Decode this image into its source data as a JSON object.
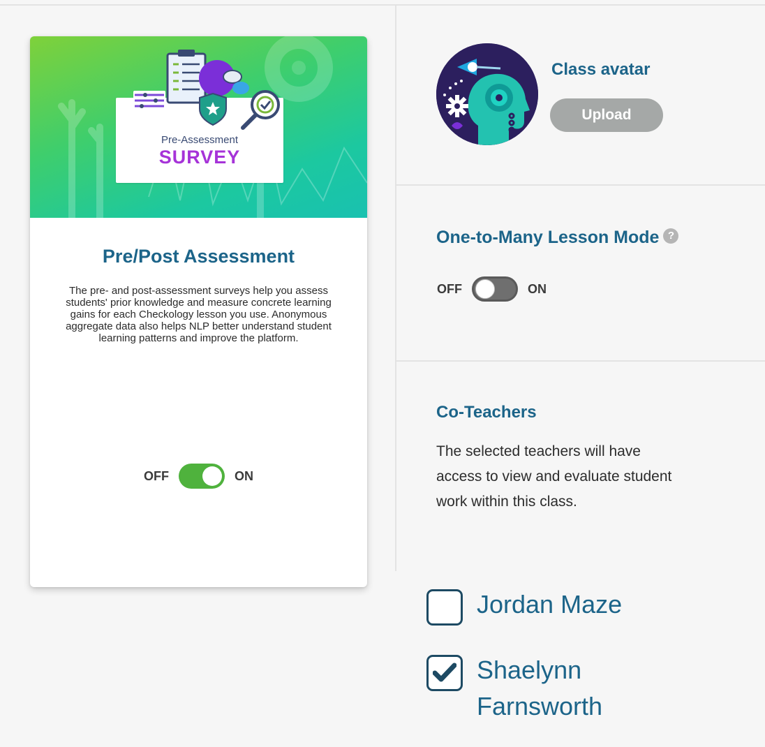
{
  "assessment_card": {
    "banner": {
      "subtitle": "Pre-Assessment",
      "title": "SURVEY"
    },
    "title": "Pre/Post Assessment",
    "description": "The pre- and post-assessment surveys help you assess students' prior knowledge and measure concrete learning gains for each Checkology lesson you use. Anonymous aggregate data also helps NLP better understand student learning patterns and improve the platform.",
    "toggle": {
      "off_label": "OFF",
      "on_label": "ON",
      "state": "on"
    }
  },
  "class_avatar": {
    "title": "Class avatar",
    "upload_label": "Upload"
  },
  "lesson_mode": {
    "title": "One-to-Many Lesson Mode",
    "help_icon": "?",
    "toggle": {
      "off_label": "OFF",
      "on_label": "ON",
      "state": "off"
    }
  },
  "co_teachers": {
    "title": "Co-Teachers",
    "description": "The selected teachers will have access to view and evaluate student work within this class.",
    "teachers": [
      {
        "name": "Jordan Maze",
        "checked": false
      },
      {
        "name": "Shaelynn Farnsworth",
        "checked": true
      }
    ]
  },
  "colors": {
    "heading": "#1c6489",
    "toggle_on": "#4fb23d",
    "toggle_off": "#6f6f6f",
    "upload_button": "#a5a8a7",
    "survey_title": "#a633d8"
  }
}
